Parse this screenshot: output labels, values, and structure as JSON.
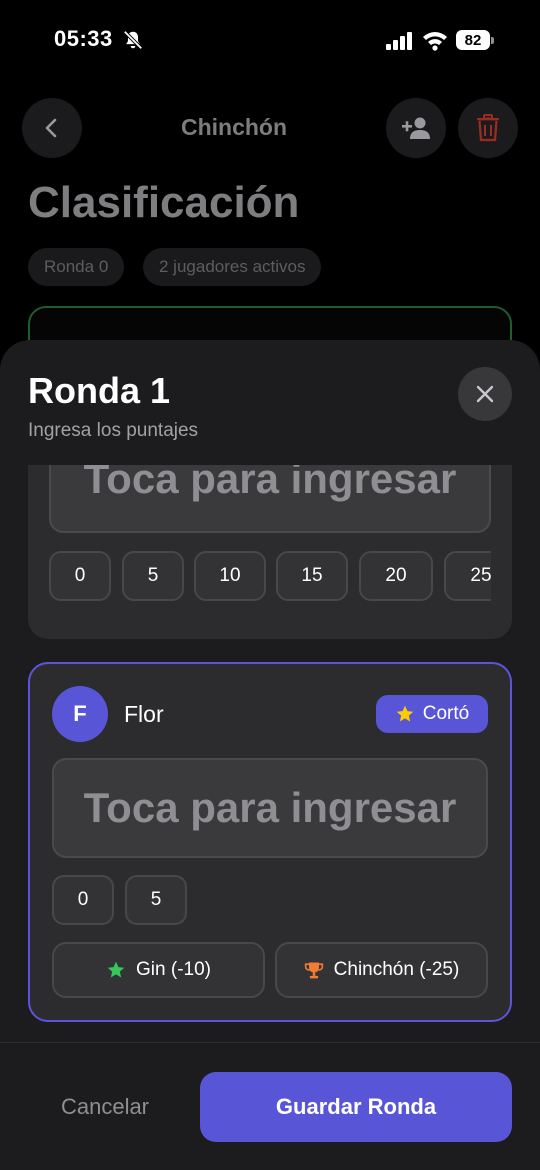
{
  "status_bar": {
    "time": "05:33",
    "battery": "82"
  },
  "header": {
    "title": "Chinchón"
  },
  "page": {
    "heading": "Clasificación",
    "chips": [
      "Ronda 0",
      "2 jugadores activos"
    ]
  },
  "sheet": {
    "title": "Ronda 1",
    "subtitle": "Ingresa los puntajes",
    "players": [
      {
        "entry_placeholder": "Toca para ingresar",
        "quick_values": [
          "0",
          "5",
          "10",
          "15",
          "20",
          "25"
        ]
      },
      {
        "initial": "F",
        "name": "Flor",
        "badge": "Cortó",
        "entry_placeholder": "Toca para ingresar",
        "quick_values": [
          "0",
          "5"
        ],
        "actions": [
          "Gin (-10)",
          "Chinchón (-25)"
        ]
      }
    ],
    "cancel_label": "Cancelar",
    "save_label": "Guardar Ronda"
  },
  "colors": {
    "accent": "#5856d6",
    "danger": "#c0392b",
    "green": "#34c759",
    "orange": "#f07d32",
    "gold": "#ffcc00"
  },
  "icons": [
    "bell-slash-icon",
    "signal-icon",
    "wifi-icon",
    "battery-icon",
    "back-chevron-icon",
    "add-person-icon",
    "trash-icon",
    "close-icon",
    "star-icon",
    "trophy-icon"
  ]
}
